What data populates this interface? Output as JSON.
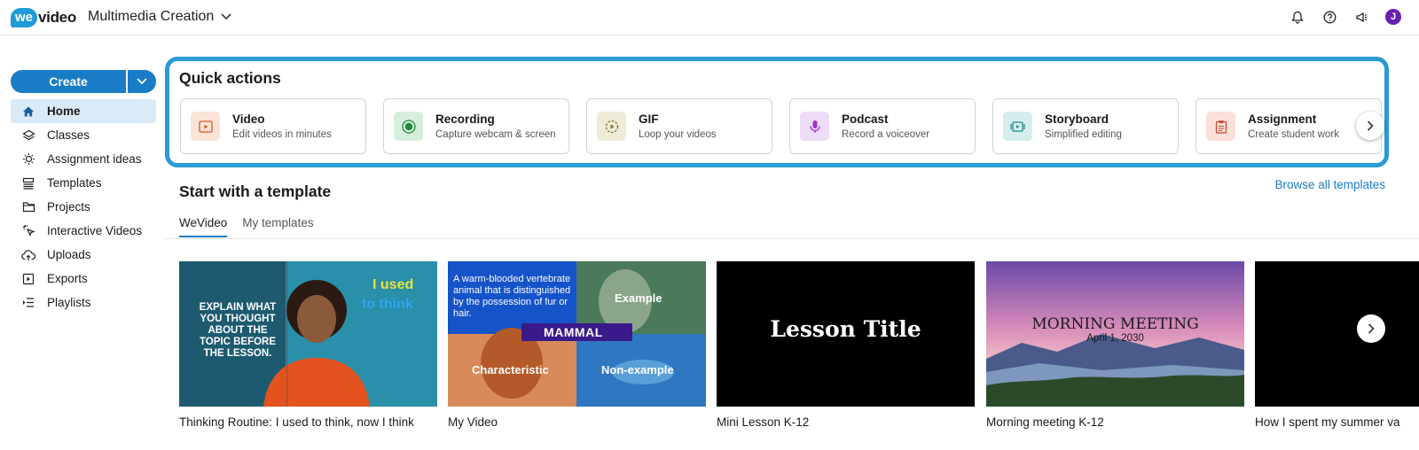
{
  "header": {
    "logo_we": "we",
    "logo_video": "video",
    "workspace": "Multimedia Creation",
    "avatar_initial": "J"
  },
  "sidebar": {
    "create_label": "Create",
    "items": [
      {
        "label": "Home",
        "icon": "home-icon",
        "active": true
      },
      {
        "label": "Classes",
        "icon": "layers-icon"
      },
      {
        "label": "Assignment ideas",
        "icon": "lightbulb-icon"
      },
      {
        "label": "Templates",
        "icon": "templates-icon"
      },
      {
        "label": "Projects",
        "icon": "folder-icon"
      },
      {
        "label": "Interactive Videos",
        "icon": "cursor-click-icon"
      },
      {
        "label": "Uploads",
        "icon": "cloud-upload-icon"
      },
      {
        "label": "Exports",
        "icon": "export-icon"
      },
      {
        "label": "Playlists",
        "icon": "playlist-icon"
      }
    ]
  },
  "quick_actions": {
    "title": "Quick actions",
    "cards": [
      {
        "title": "Video",
        "subtitle": "Edit videos in minutes",
        "icon": "video-icon",
        "bg": "#fbe3d6",
        "fg": "#d4572a"
      },
      {
        "title": "Recording",
        "subtitle": "Capture webcam & screen",
        "icon": "record-icon",
        "bg": "#d8eedd",
        "fg": "#1e8a3a"
      },
      {
        "title": "GIF",
        "subtitle": "Loop your videos",
        "icon": "gif-icon",
        "bg": "#eeecd8",
        "fg": "#7a7430"
      },
      {
        "title": "Podcast",
        "subtitle": "Record a voiceover",
        "icon": "microphone-icon",
        "bg": "#eedcf7",
        "fg": "#9b34c8"
      },
      {
        "title": "Storyboard",
        "subtitle": "Simplified editing",
        "icon": "storyboard-icon",
        "bg": "#d5eeed",
        "fg": "#1e8a88"
      },
      {
        "title": "Assignment",
        "subtitle": "Create student work",
        "icon": "clipboard-icon",
        "bg": "#fbe0da",
        "fg": "#c94a30"
      }
    ]
  },
  "templates": {
    "title": "Start with a template",
    "browse_label": "Browse all templates",
    "tabs": [
      {
        "label": "WeVideo",
        "active": true
      },
      {
        "label": "My templates",
        "active": false
      }
    ],
    "items": [
      {
        "caption": "Thinking Routine: I used to think, now I think",
        "overlay": [
          "EXPLAIN WHAT",
          "YOU THOUGHT",
          "ABOUT THE",
          "TOPIC BEFORE",
          "THE LESSON."
        ],
        "overlay2": "I used",
        "overlay3": "to think"
      },
      {
        "caption": "My Video",
        "definition": "A warm-blooded vertebrate animal that is distinguished by the possession of fur or hair.",
        "example": "Example",
        "word": "MAMMAL",
        "characteristic": "Characteristic",
        "nonexample": "Non-example"
      },
      {
        "caption": "Mini Lesson K-12",
        "overlay": "Lesson Title"
      },
      {
        "caption": "Morning meeting K-12",
        "overlay": "MORNING MEETING",
        "date": "April 1, 2030"
      },
      {
        "caption": "How I spent my summer va"
      }
    ]
  }
}
